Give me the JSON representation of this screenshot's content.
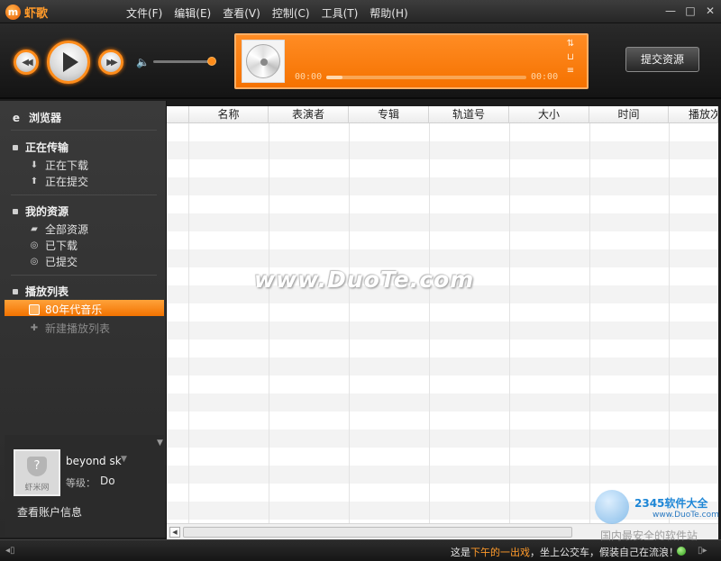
{
  "app": {
    "logo_mark": "m",
    "name": "虾歌"
  },
  "menu": [
    "文件(F)",
    "编辑(E)",
    "查看(V)",
    "控制(C)",
    "工具(T)",
    "帮助(H)"
  ],
  "window_controls": {
    "minimize": "—",
    "maximize": "□",
    "close": "✕"
  },
  "player": {
    "time_elapsed": "00:00",
    "time_total": "00:00",
    "progress": 0.08,
    "volume": 0.95,
    "submit_button": "提交资源"
  },
  "sidebar": {
    "browser": "浏览器",
    "transfer": {
      "title": "正在传输",
      "items": [
        "正在下载",
        "正在提交"
      ]
    },
    "resources": {
      "title": "我的资源",
      "items": [
        "全部资源",
        "已下载",
        "已提交"
      ]
    },
    "playlist": {
      "title": "播放列表",
      "selected": "80年代音乐",
      "new_item": "新建播放列表"
    }
  },
  "account": {
    "avatar_text": "虾米网",
    "username": "beyond sk",
    "level_label": "等级：",
    "level_value": "Do",
    "link": "查看账户信息"
  },
  "table": {
    "columns": [
      "",
      "名称",
      "表演者",
      "专辑",
      "轨道号",
      "大小",
      "时间",
      "播放次"
    ]
  },
  "watermarks": {
    "center": "www.DuoTe.com",
    "brand": "2345软件大全",
    "url": "www.DuoTe.com",
    "slogan": "国内最安全的软件站"
  },
  "status": {
    "prefix": "这是",
    "link": "下午的一出戏",
    "suffix": "，坐上公交车，假装自己在流浪！"
  },
  "colors": {
    "accent": "#f57200",
    "accent_light": "#ff9a2a",
    "status_online": "#2a9a13"
  }
}
